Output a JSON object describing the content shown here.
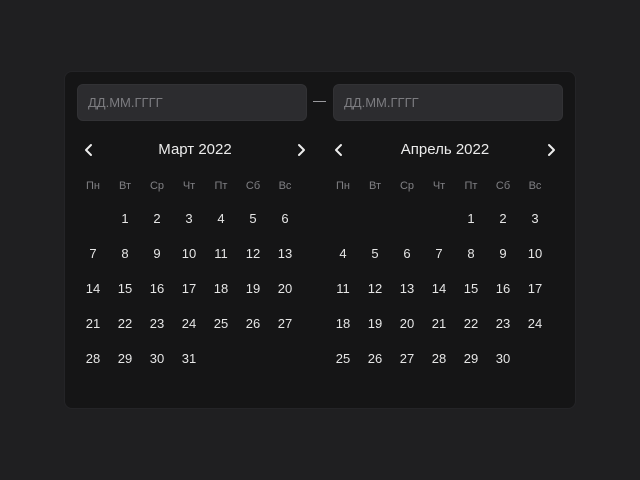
{
  "inputs": {
    "start_placeholder": "ДД.ММ.ГГГГ",
    "end_placeholder": "ДД.ММ.ГГГГ"
  },
  "weekdays": [
    "Пн",
    "Вт",
    "Ср",
    "Чт",
    "Пт",
    "Сб",
    "Вс"
  ],
  "months": [
    {
      "title": "Март 2022",
      "offset": 1,
      "days": 31
    },
    {
      "title": "Апрель 2022",
      "offset": 4,
      "days": 30
    }
  ],
  "icons": {
    "prev": "chevron-left-icon",
    "next": "chevron-right-icon"
  }
}
